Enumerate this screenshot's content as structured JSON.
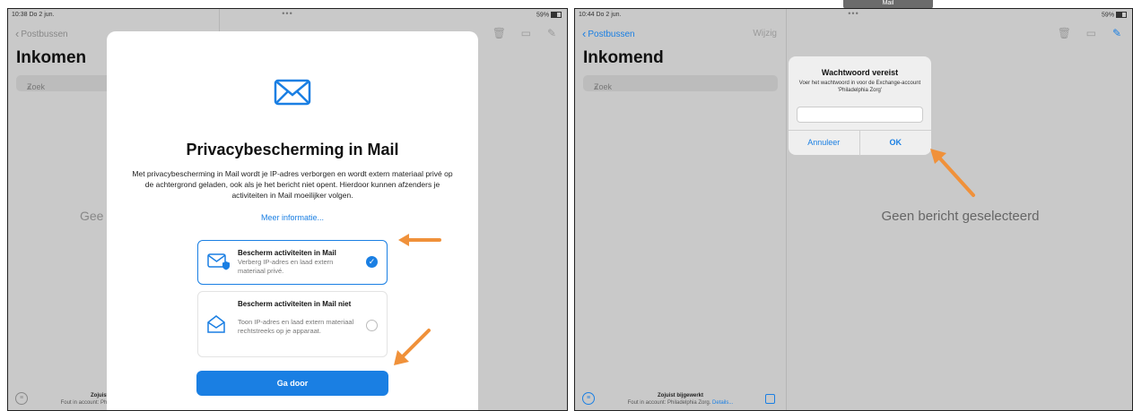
{
  "tooltip_label": "Mail",
  "left": {
    "status": {
      "time": "10:38 Do 2 jun.",
      "dots": "•••",
      "battery": "59%"
    },
    "sidebar": {
      "back_label": "Postbussen",
      "title": "Inkomen",
      "search_placeholder": "Zoek",
      "footer_status": "Zojuist bijgewerkt",
      "footer_error": "Fout in account: Philadelphia Zorg. Details..."
    },
    "detail_text_partial": "Gee",
    "modal": {
      "title": "Privacybescherming in Mail",
      "description": "Met privacybescherming in Mail wordt je IP-adres verborgen en wordt extern materiaal privé op de achtergrond geladen, ook als je het bericht niet opent. Hierdoor kunnen afzenders je activiteiten in Mail moeilijker volgen.",
      "more_link": "Meer informatie...",
      "option_1": {
        "title": "Bescherm activiteiten in Mail",
        "description": "Verberg IP-adres en laad extern materiaal privé.",
        "selected": true
      },
      "option_2": {
        "title": "Bescherm activiteiten in Mail niet",
        "description": "Toon IP-adres en laad extern materiaal rechtstreeks op je apparaat.",
        "selected": false
      },
      "continue_label": "Ga door"
    }
  },
  "right": {
    "status": {
      "time": "10:44 Do 2 jun.",
      "dots": "•••",
      "battery": "59%"
    },
    "sidebar": {
      "back_label": "Postbussen",
      "edit_label": "Wijzig",
      "title": "Inkomend",
      "search_placeholder": "Zoek",
      "footer_status": "Zojuist bijgewerkt",
      "footer_error": "Fout in account: Philadelphia Zorg.",
      "footer_details": "Details..."
    },
    "no_message": "Geen bericht geselecteerd",
    "alert": {
      "title": "Wachtwoord vereist",
      "message": "Voer het wachtwoord in voor de Exchange-account 'Philadelphia Zorg'",
      "password_value": "",
      "cancel_label": "Annuleer",
      "ok_label": "OK"
    }
  },
  "icons": {
    "back": "chevron-left-icon",
    "search": "search-icon",
    "trash": "trash-icon",
    "folder": "folder-icon",
    "compose": "compose-icon",
    "mail": "envelope-icon",
    "annotation_arrow": "orange-arrow-icon"
  },
  "colors": {
    "accent": "#1a7fe3",
    "annotation": "#f0913a",
    "backdrop": "#c9c9c9"
  }
}
